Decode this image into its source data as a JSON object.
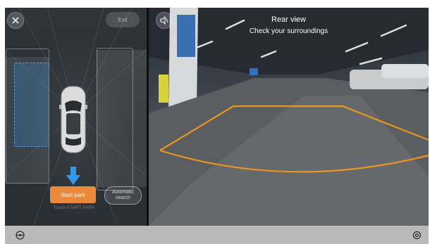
{
  "left": {
    "close_icon": "close-icon",
    "exit_label": "Exit",
    "start_park_label": "Start park",
    "automatic_search_label": "Automatic search",
    "touch_hint": "Touch START PARK"
  },
  "camera": {
    "mute_icon": "speaker-mute-icon",
    "title": "Rear view",
    "subtitle": "Check your surroundings",
    "guide_line_color": "#e8961e"
  },
  "bottom_bar": {
    "left_icon": "steering-wheel-icon",
    "right_icon": "settings-icon"
  },
  "colors": {
    "start_button": "#e88a3a",
    "arrow": "#2f9bf0",
    "slot_highlight": "#3b8fd6"
  }
}
